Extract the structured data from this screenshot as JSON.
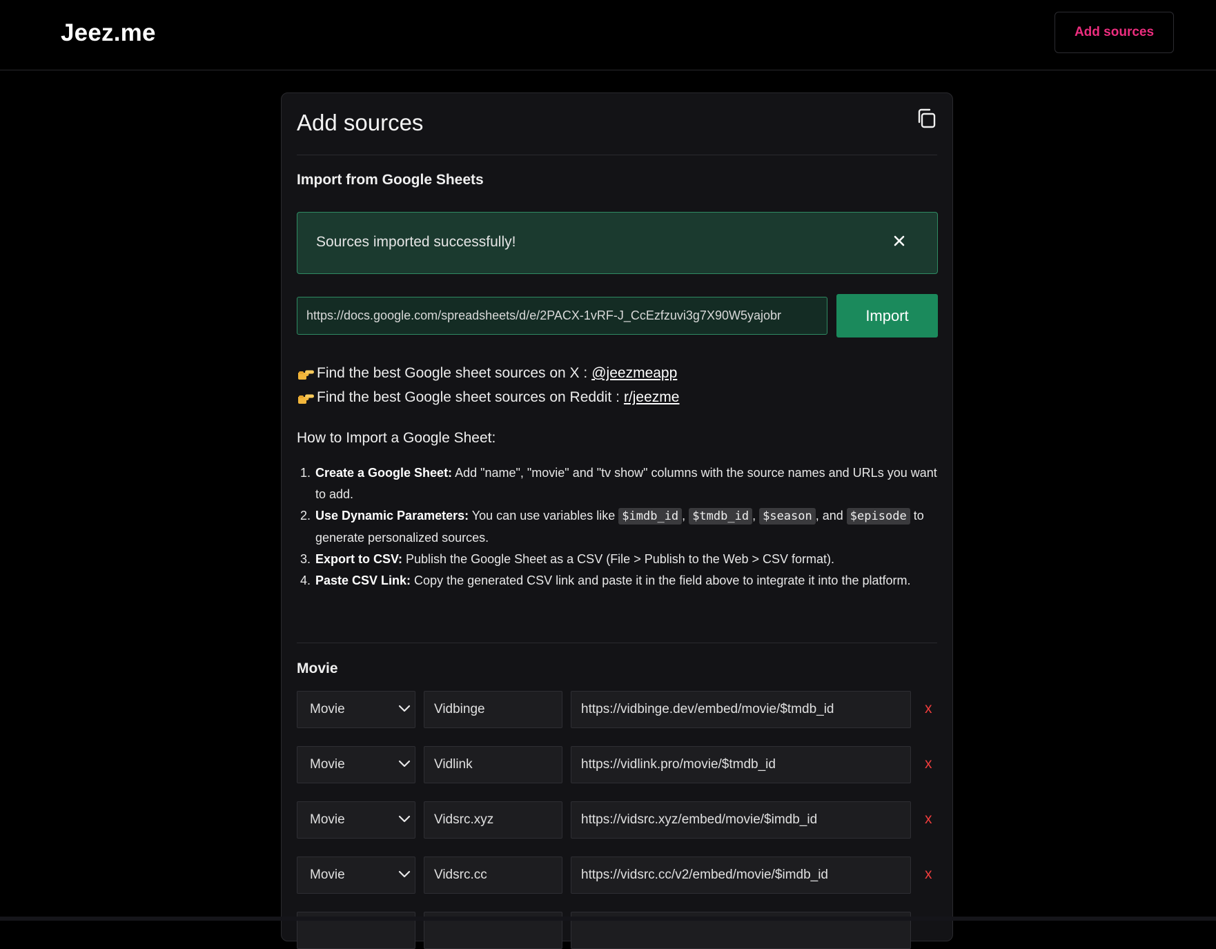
{
  "header": {
    "brand": "Jeez.me",
    "add_sources_label": "Add sources"
  },
  "panel": {
    "title": "Add sources",
    "import_title": "Import from Google Sheets",
    "alert_message": "Sources imported successfully!",
    "sheet_url": "https://docs.google.com/spreadsheets/d/e/2PACX-1vRF-J_CcEzfzuvi3g7X90W5yajobr",
    "import_label": "Import",
    "find_x": {
      "text": "Find the best Google sheet sources on X :",
      "link": "@jeezmeapp"
    },
    "find_reddit": {
      "text": "Find the best Google sheet sources on Reddit :",
      "link": "r/jeezme"
    },
    "how_title": "How to Import a Google Sheet:",
    "steps": [
      {
        "num": "1.",
        "title": "Create a Google Sheet:",
        "text": " Add \"name\", \"movie\" and \"tv show\" columns with the source names and URLs you want to add."
      },
      {
        "num": "2.",
        "title": "Use Dynamic Parameters:",
        "text_before": " You can use variables like ",
        "vars": [
          "$imdb_id",
          "$tmdb_id",
          "$season",
          "$episode"
        ],
        "sep1": ", ",
        "sep2": ", ",
        "sep3": ", and ",
        "text_after": " to generate personalized sources."
      },
      {
        "num": "3.",
        "title": "Export to CSV:",
        "text": " Publish the Google Sheet as a CSV (File > Publish to the Web > CSV format)."
      },
      {
        "num": "4.",
        "title": "Paste CSV Link:",
        "text": " Copy the generated CSV link and paste it in the field above to integrate it into the platform."
      }
    ],
    "movie_section_title": "Movie",
    "sources": [
      {
        "type": "Movie",
        "name": "Vidbinge",
        "url": "https://vidbinge.dev/embed/movie/$tmdb_id",
        "delete": "x"
      },
      {
        "type": "Movie",
        "name": "Vidlink",
        "url": "https://vidlink.pro/movie/$tmdb_id",
        "delete": "x"
      },
      {
        "type": "Movie",
        "name": "Vidsrc.xyz",
        "url": "https://vidsrc.xyz/embed/movie/$imdb_id",
        "delete": "x"
      },
      {
        "type": "Movie",
        "name": "Vidsrc.cc",
        "url": "https://vidsrc.cc/v2/embed/movie/$imdb_id",
        "delete": "x"
      },
      {
        "type": "",
        "name": "",
        "url": "",
        "delete": ""
      }
    ]
  },
  "colors": {
    "accent_pink": "#ec2d7e",
    "success_green": "#1b8a5c",
    "delete_red": "#ef3d3d"
  }
}
